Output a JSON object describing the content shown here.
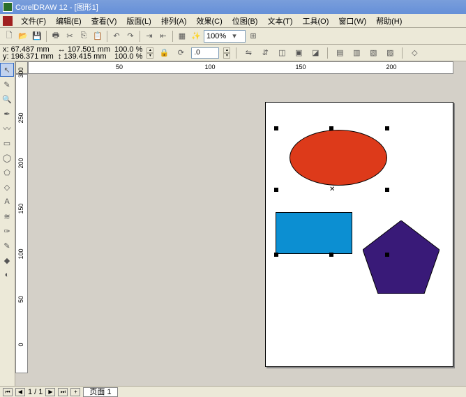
{
  "title": "CorelDRAW 12 - [图形1]",
  "menu": {
    "file": "文件(F)",
    "edit": "编辑(E)",
    "view": "查看(V)",
    "layout": "版面(L)",
    "arrange": "排列(A)",
    "effects": "效果(C)",
    "bitmaps": "位图(B)",
    "text": "文本(T)",
    "tools": "工具(O)",
    "window": "窗口(W)",
    "help": "帮助(H)"
  },
  "toolbar": {
    "zoom": "100%"
  },
  "props": {
    "x_label": "x:",
    "y_label": "y:",
    "x": "67.487 mm",
    "y": "196.371 mm",
    "w": "107.501 mm",
    "h": "139.415 mm",
    "sx": "100.0",
    "sy": "100.0",
    "pct": "%",
    "rot": ".0"
  },
  "ruler_h": {
    "t0": "50",
    "t1": "100",
    "t2": "150",
    "t3": "200"
  },
  "ruler_v": {
    "t0": "300",
    "t1": "250",
    "t2": "200",
    "t3": "150",
    "t4": "100",
    "t5": "50",
    "t6": "0"
  },
  "shapes": {
    "ellipse_fill": "#dd3a1a",
    "rect_fill": "#0c8fd2",
    "pentagon_fill": "#391a78"
  },
  "status": {
    "page_count": "1 / 1",
    "page_tab": "页面 1"
  }
}
